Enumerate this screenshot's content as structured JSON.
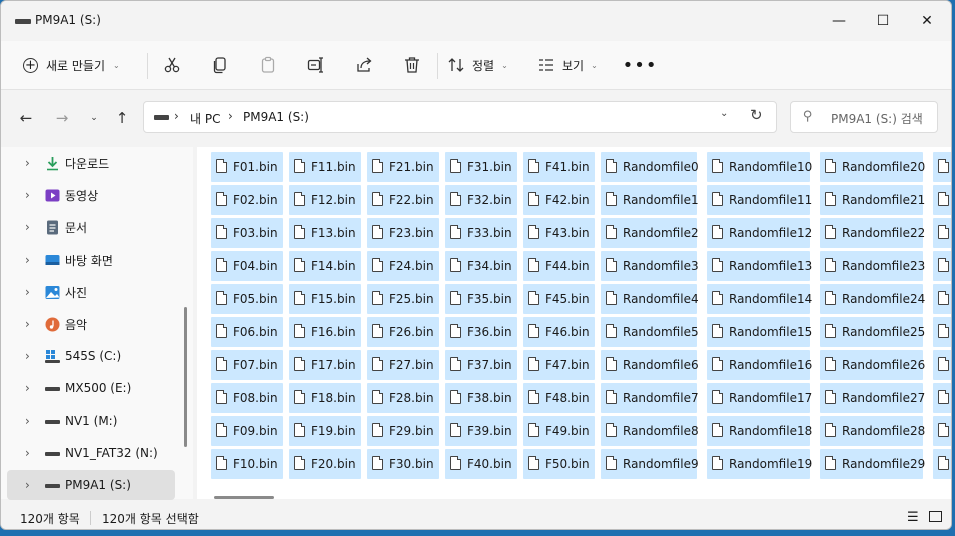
{
  "window": {
    "title": "PM9A1 (S:)"
  },
  "window_controls": {
    "minimize": "—",
    "maximize": "☐",
    "close": "✕"
  },
  "toolbar": {
    "new_label": "새로 만들기",
    "sort_label": "정렬",
    "view_label": "보기",
    "more_label": "•••",
    "icons": [
      "cut-icon",
      "copy-icon",
      "paste-icon",
      "rename-icon",
      "share-icon",
      "delete-icon"
    ]
  },
  "address": {
    "segments": [
      "내 PC",
      "PM9A1 (S:)"
    ]
  },
  "search": {
    "placeholder": "PM9A1 (S:) 검색"
  },
  "sidebar": {
    "items": [
      {
        "label": "다운로드",
        "icon": "download-icon",
        "color": "#2a9d5c"
      },
      {
        "label": "동영상",
        "icon": "video-icon",
        "color": "#7b3fc4"
      },
      {
        "label": "문서",
        "icon": "document-icon",
        "color": "#5a6b7d"
      },
      {
        "label": "바탕 화면",
        "icon": "desktop-icon",
        "color": "#2b88d8"
      },
      {
        "label": "사진",
        "icon": "pictures-icon",
        "color": "#2b88d8"
      },
      {
        "label": "음악",
        "icon": "music-icon",
        "color": "#e06b3a"
      },
      {
        "label": "545S (C:)",
        "icon": "windows-drive-icon",
        "color": "#2b88d8"
      },
      {
        "label": "MX500 (E:)",
        "icon": "drive-icon",
        "color": "#444444"
      },
      {
        "label": "NV1 (M:)",
        "icon": "drive-icon",
        "color": "#444444"
      },
      {
        "label": "NV1_FAT32 (N:)",
        "icon": "drive-icon",
        "color": "#444444"
      },
      {
        "label": "PM9A1 (S:)",
        "icon": "drive-icon",
        "color": "#444444",
        "selected": true
      }
    ]
  },
  "files": {
    "columns": [
      [
        "F01.bin",
        "F02.bin",
        "F03.bin",
        "F04.bin",
        "F05.bin",
        "F06.bin",
        "F07.bin",
        "F08.bin",
        "F09.bin",
        "F10.bin"
      ],
      [
        "F11.bin",
        "F12.bin",
        "F13.bin",
        "F14.bin",
        "F15.bin",
        "F16.bin",
        "F17.bin",
        "F18.bin",
        "F19.bin",
        "F20.bin"
      ],
      [
        "F21.bin",
        "F22.bin",
        "F23.bin",
        "F24.bin",
        "F25.bin",
        "F26.bin",
        "F27.bin",
        "F28.bin",
        "F29.bin",
        "F30.bin"
      ],
      [
        "F31.bin",
        "F32.bin",
        "F33.bin",
        "F34.bin",
        "F35.bin",
        "F36.bin",
        "F37.bin",
        "F38.bin",
        "F39.bin",
        "F40.bin"
      ],
      [
        "F41.bin",
        "F42.bin",
        "F43.bin",
        "F44.bin",
        "F45.bin",
        "F46.bin",
        "F47.bin",
        "F48.bin",
        "F49.bin",
        "F50.bin"
      ],
      [
        "Randomfile0",
        "Randomfile1",
        "Randomfile2",
        "Randomfile3",
        "Randomfile4",
        "Randomfile5",
        "Randomfile6",
        "Randomfile7",
        "Randomfile8",
        "Randomfile9"
      ],
      [
        "Randomfile10",
        "Randomfile11",
        "Randomfile12",
        "Randomfile13",
        "Randomfile14",
        "Randomfile15",
        "Randomfile16",
        "Randomfile17",
        "Randomfile18",
        "Randomfile19"
      ],
      [
        "Randomfile20",
        "Randomfile21",
        "Randomfile22",
        "Randomfile23",
        "Randomfile24",
        "Randomfile25",
        "Randomfile26",
        "Randomfile27",
        "Randomfile28",
        "Randomfile29"
      ],
      [
        "",
        "",
        "",
        "",
        "",
        "",
        "",
        "",
        "",
        ""
      ]
    ],
    "selection_color": "#cce8ff"
  },
  "status": {
    "count": "120개 항목",
    "selected": "120개 항목 선택함"
  }
}
